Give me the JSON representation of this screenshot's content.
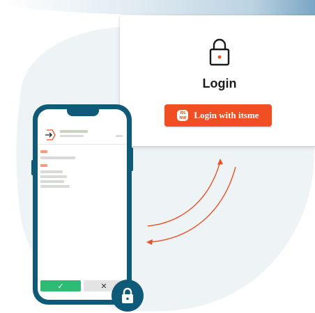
{
  "login_card": {
    "title": "Login",
    "button_label": "Login with itsme",
    "brand_logo_text": "its me"
  },
  "phone": {
    "confirm_label": "✓",
    "reject_label": "✕"
  },
  "colors": {
    "accent": "#f04e23",
    "phone_frame": "#0f5a79",
    "confirm": "#2dbb75"
  },
  "icons": [
    "padlock-icon",
    "itsme-logo-icon",
    "arrow-icon",
    "lock-icon"
  ]
}
